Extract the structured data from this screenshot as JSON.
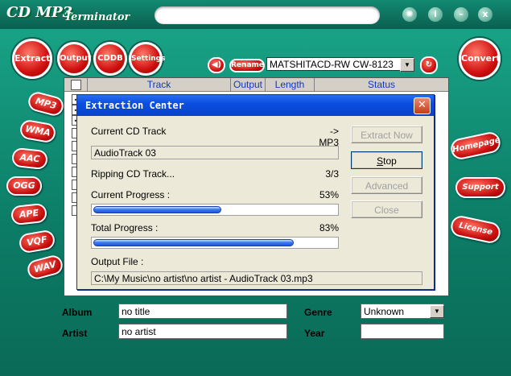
{
  "app": {
    "title_main": "CD MP3",
    "title_sub": "Terminator",
    "window_buttons": [
      "✺",
      "i",
      "–",
      "x"
    ]
  },
  "top_tabs": [
    "Extract",
    "Output",
    "CDDB",
    "Settings"
  ],
  "convert_label": "Convert",
  "rename_label": "Rename",
  "drive": {
    "selected": "MATSHITACD-RW  CW-8123"
  },
  "format_buttons": [
    "MP3",
    "WMA",
    "AAC",
    "OGG",
    "APE",
    "VQF",
    "WAV"
  ],
  "right_buttons": [
    "Homepage",
    "Support",
    "License"
  ],
  "list": {
    "columns": [
      "Track",
      "Output",
      "Length",
      "Status"
    ]
  },
  "bottom": {
    "album_label": "Album",
    "album_value": "no title",
    "artist_label": "Artist",
    "artist_value": "no artist",
    "genre_label": "Genre",
    "genre_value": "Unknown",
    "year_label": "Year",
    "year_value": ""
  },
  "dialog": {
    "title": "Extraction Center",
    "close_glyph": "✕",
    "current_track_label": "Current CD Track",
    "target_format": "-> MP3",
    "track_name": "AudioTrack 03",
    "ripping_label": "Ripping CD Track...",
    "ripping_count": "3/3",
    "current_progress_label": "Current Progress :",
    "current_progress_pct": "53%",
    "current_progress_value": 0.53,
    "total_progress_label": "Total Progress :",
    "total_progress_pct": "83%",
    "total_progress_value": 0.83,
    "output_file_label": "Output File :",
    "output_file_path": "C:\\My Music\\no artist\\no artist - AudioTrack 03.mp3",
    "buttons": {
      "extract_now": "Extract Now",
      "stop": "Stop",
      "advanced": "Advanced",
      "close": "Close"
    }
  },
  "colors": {
    "shell": "#0c7c66",
    "accent_red": "#c80f0f",
    "dialog_title": "#0a4ee0",
    "progress": "#3a7cf0"
  }
}
